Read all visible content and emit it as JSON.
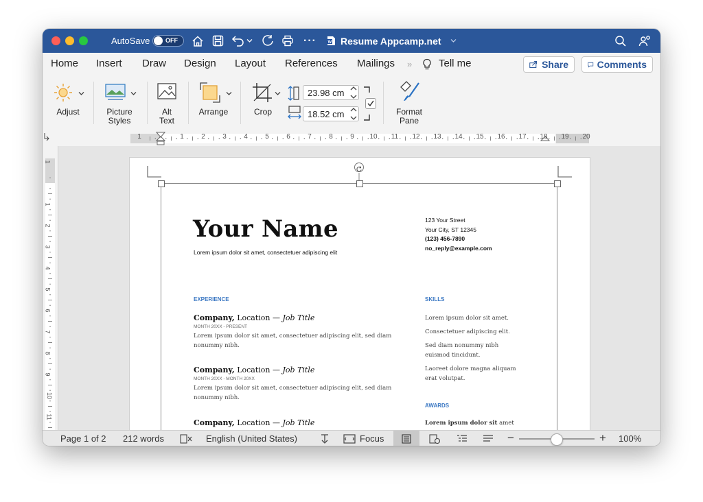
{
  "titlebar": {
    "autosave_label": "AutoSave",
    "autosave_state": "OFF",
    "document_title": "Resume Appcamp.net",
    "icons": [
      "home-icon",
      "save-icon",
      "undo-icon",
      "redo-icon",
      "print-icon",
      "more-icon",
      "search-icon",
      "share-people-icon"
    ]
  },
  "tabs": [
    "Home",
    "Insert",
    "Draw",
    "Design",
    "Layout",
    "References",
    "Mailings",
    "Tell me"
  ],
  "share_label": "Share",
  "comments_label": "Comments",
  "ribbon": {
    "adjust": "Adjust",
    "picture_styles_1": "Picture",
    "picture_styles_2": "Styles",
    "alt_text_1": "Alt",
    "alt_text_2": "Text",
    "arrange": "Arrange",
    "crop": "Crop",
    "height_value": "23.98 cm",
    "width_value": "18.52 cm",
    "format_pane_1": "Format",
    "format_pane_2": "Pane"
  },
  "ruler_numbers": [
    "1",
    "1",
    "2",
    "3",
    "4",
    "5",
    "6",
    "7",
    "8",
    "9",
    "10",
    "11",
    "12",
    "13",
    "14",
    "15",
    "16",
    "17",
    "18",
    "19",
    "20"
  ],
  "vruler_numbers": [
    "1",
    "1",
    "2",
    "3",
    "4",
    "5",
    "6",
    "7",
    "8",
    "9",
    "10",
    "11"
  ],
  "resume": {
    "name": "Your Name",
    "tagline": "Lorem ipsum dolor sit amet, consectetuer adipiscing elit",
    "address1": "123 Your Street",
    "address2": "Your City, ST 12345",
    "phone": "(123) 456-7890",
    "email": "no_reply@example.com",
    "experience_heading": "EXPERIENCE",
    "jobs": [
      {
        "company": "Company,",
        "location": " Location — ",
        "title": "Job Title",
        "dates": "MONTH 20XX - PRESENT",
        "desc1": "Lorem ipsum dolor sit amet, consectetuer adipiscing elit, sed diam",
        "desc2": "nonummy nibh."
      },
      {
        "company": "Company,",
        "location": " Location — ",
        "title": "Job Title",
        "dates": "MONTH 20XX - MONTH 20XX",
        "desc1": "Lorem ipsum dolor sit amet, consectetuer adipiscing elit, sed diam",
        "desc2": "nonummy nibh."
      },
      {
        "company": "Company,",
        "location": " Location — ",
        "title": "Job Title"
      }
    ],
    "skills_heading": "SKILLS",
    "skills": [
      "Lorem ipsum dolor sit amet.",
      "Consectetuer adipiscing elit.",
      "Sed diam nonummy nibh",
      "euismod tincidunt.",
      "Laoreet dolore magna aliquam",
      "erat volutpat."
    ],
    "awards_heading": "AWARDS",
    "award1_bold": "Lorem ipsum dolor sit",
    "award1_rest": " amet"
  },
  "status": {
    "page": "Page 1 of 2",
    "words": "212 words",
    "language": "English (United States)",
    "focus": "Focus",
    "zoom": "100%",
    "zoom_minus": "−",
    "zoom_plus": "+"
  },
  "colors": {
    "titlebar": "#2b579a",
    "accent": "#2b579a",
    "section_heading": "#3b78c3",
    "close": "#ff5f57",
    "minimize": "#febc2e",
    "maximize": "#28c840"
  }
}
